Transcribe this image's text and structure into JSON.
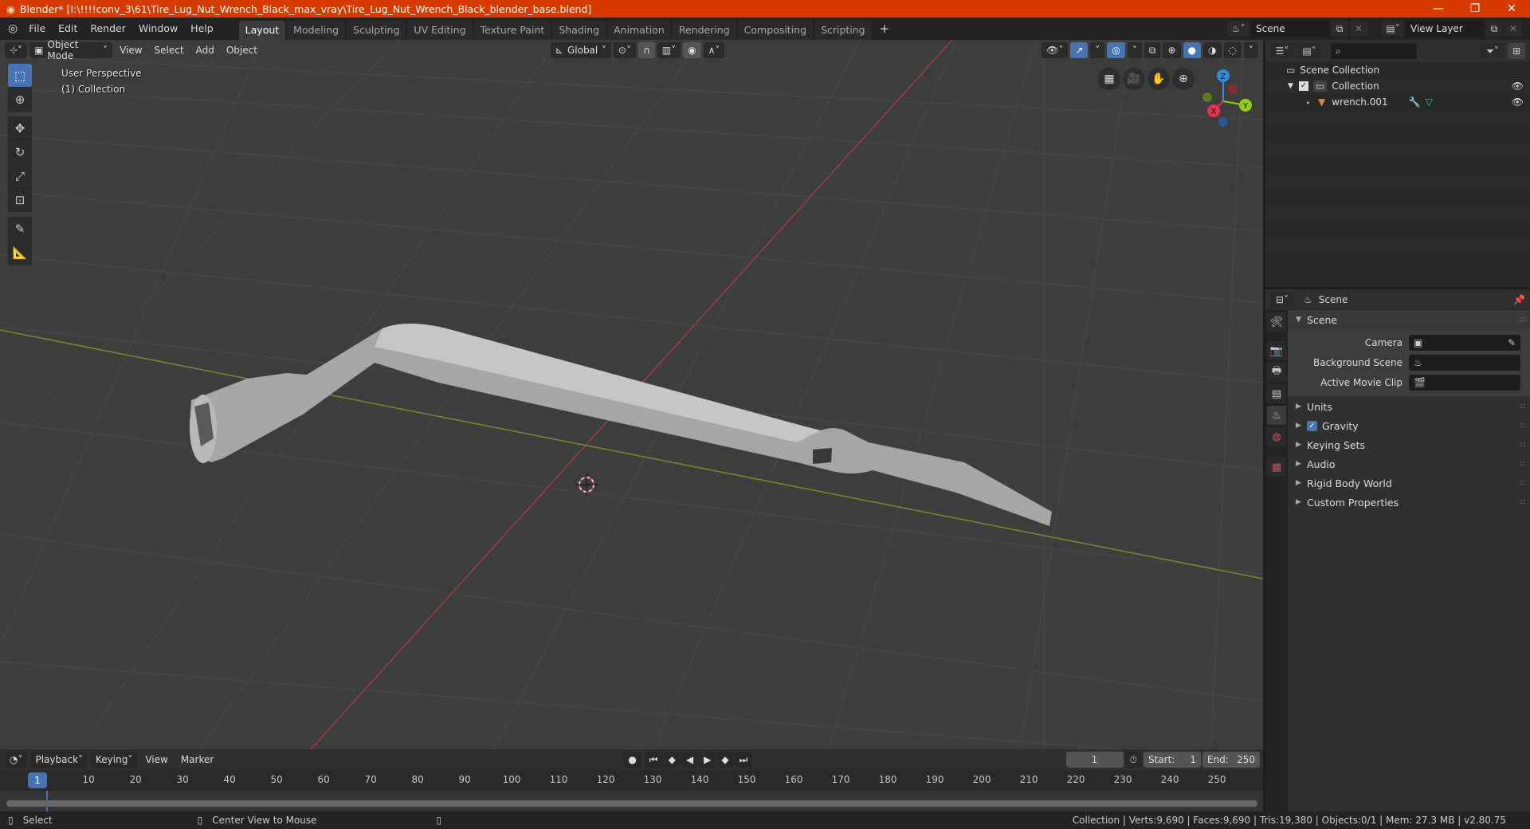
{
  "window": {
    "title": "Blender* [I:\\!!!!conv_3\\61\\Tire_Lug_Nut_Wrench_Black_max_vray\\Tire_Lug_Nut_Wrench_Black_blender_base.blend]",
    "minimize": "—",
    "maximize": "❐",
    "close": "✕"
  },
  "menu": [
    "File",
    "Edit",
    "Render",
    "Window",
    "Help"
  ],
  "workspaces": [
    "Layout",
    "Modeling",
    "Sculpting",
    "UV Editing",
    "Texture Paint",
    "Shading",
    "Animation",
    "Rendering",
    "Compositing",
    "Scripting"
  ],
  "active_workspace": "Layout",
  "add_workspace": "+",
  "scene_selector": {
    "value": "Scene"
  },
  "view_layer_selector": {
    "value": "View Layer"
  },
  "viewport": {
    "mode": "Object Mode",
    "menus": [
      "View",
      "Select",
      "Add",
      "Object"
    ],
    "transform_orientation": "Global",
    "overlay_title": "User Perspective",
    "overlay_subtitle": "(1) Collection",
    "gizmo": {
      "x": "X",
      "y": "Y",
      "z": "Z"
    },
    "colors": {
      "x_axis": "#c44a5a",
      "y_axis": "#7ea33a",
      "grid_bg": "#3d3d3d",
      "model": "#b8b8b8"
    }
  },
  "outliner": {
    "root": "Scene Collection",
    "items": [
      {
        "name": "Collection",
        "type": "collection",
        "checked": true,
        "visible": true
      },
      {
        "name": "wrench.001",
        "type": "mesh-object",
        "visible": true
      }
    ]
  },
  "properties": {
    "context": "Scene",
    "section_title": "Scene",
    "fields": [
      {
        "label": "Camera",
        "value": ""
      },
      {
        "label": "Background Scene",
        "value": ""
      },
      {
        "label": "Active Movie Clip",
        "value": ""
      }
    ],
    "panels": [
      {
        "label": "Units"
      },
      {
        "label": "Gravity",
        "checkbox": true
      },
      {
        "label": "Keying Sets"
      },
      {
        "label": "Audio"
      },
      {
        "label": "Rigid Body World"
      },
      {
        "label": "Custom Properties"
      }
    ]
  },
  "timeline": {
    "menus": [
      "Playback",
      "Keying",
      "View",
      "Marker"
    ],
    "current_frame": "1",
    "start_label": "Start:",
    "start": "1",
    "end_label": "End:",
    "end": "250",
    "ticks": [
      "10",
      "20",
      "30",
      "40",
      "50",
      "60",
      "70",
      "80",
      "90",
      "100",
      "110",
      "120",
      "130",
      "140",
      "150",
      "160",
      "170",
      "180",
      "190",
      "200",
      "210",
      "220",
      "230",
      "240",
      "250"
    ],
    "playhead": "1"
  },
  "statusbar": {
    "left_hint": "Select",
    "middle_hint": "Center View to Mouse",
    "stats": "Collection | Verts:9,690 | Faces:9,690 | Tris:19,380 | Objects:0/1 | Mem: 27.3 MB | v2.80.75"
  }
}
